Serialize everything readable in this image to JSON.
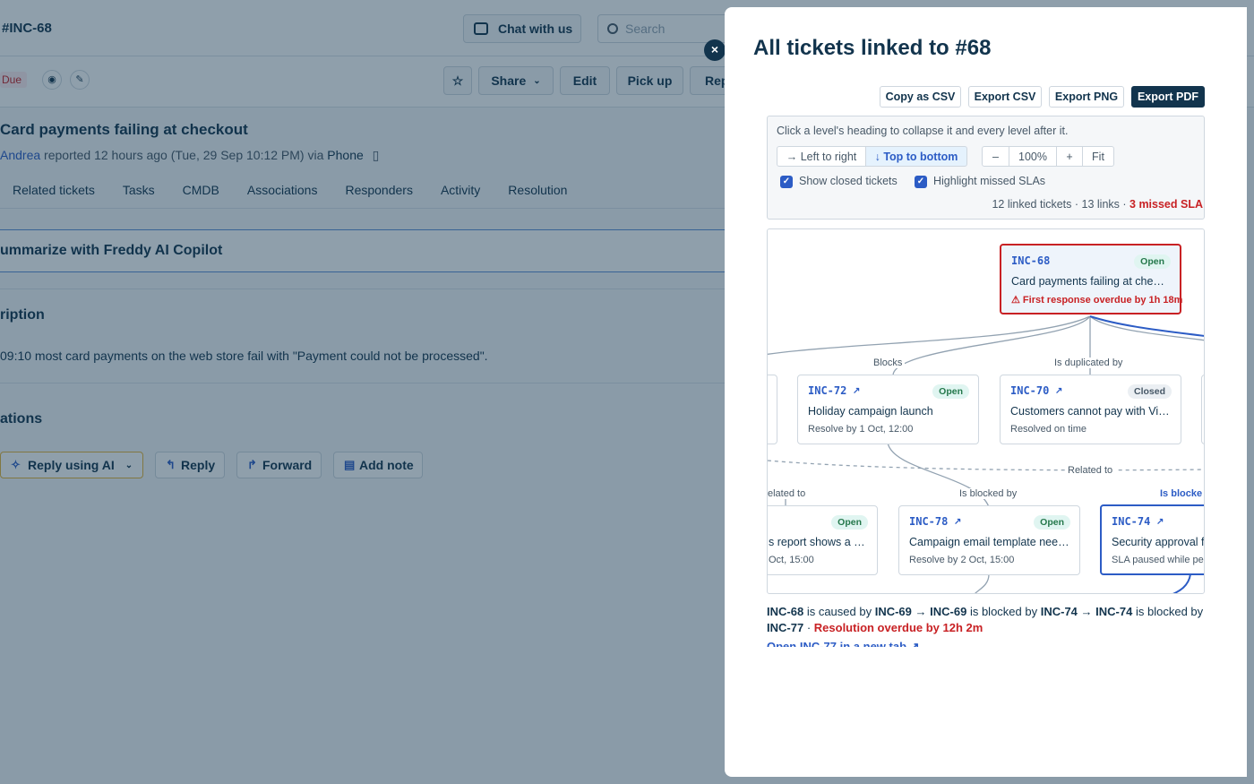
{
  "ticket": {
    "id": "#INC-68",
    "due_badge": "Due",
    "subject": "Card payments failing at checkout",
    "reporter": "Andrea",
    "reported_text": "reported 12 hours ago (Tue, 29 Sep 10:12 PM) via",
    "channel": "Phone",
    "description_title": "ription",
    "description_text": "09:10 most card payments on the web store fail with \"Payment could not be processed\".",
    "freddy_label": "ummarize with Freddy AI Copilot",
    "conversations_title": "ations"
  },
  "topbar": {
    "chat_label": "Chat with us",
    "search_placeholder": "Search"
  },
  "actions": {
    "share": "Share",
    "edit": "Edit",
    "pick_up": "Pick up",
    "reply_cut": "Rep"
  },
  "tabs": [
    "Related tickets",
    "Tasks",
    "CMDB",
    "Associations",
    "Responders",
    "Activity",
    "Resolution"
  ],
  "reply_bar": {
    "ai": "Reply using AI",
    "reply": "Reply",
    "forward": "Forward",
    "note": "Add note"
  },
  "panel": {
    "title": "All tickets linked to #68",
    "close": "×",
    "export": {
      "copy_csv": "Copy as CSV",
      "csv": "Export CSV",
      "png": "Export PNG",
      "pdf": "Export PDF"
    },
    "hint": "Click a level's heading to collapse it and every level after it.",
    "layout": {
      "ltr": "→ Left to right",
      "ttb": "↓ Top to bottom"
    },
    "zoom": {
      "minus": "–",
      "level": "100%",
      "plus": "+",
      "fit": "Fit"
    },
    "show_closed": "Show closed tickets",
    "highlight_sla": "Highlight missed SLAs",
    "summary_main": "12 linked tickets · 13 links ·",
    "summary_missed": "3 missed SLA"
  },
  "graph": {
    "nodes": {
      "root": {
        "id": "INC-68",
        "status": "Open",
        "title": "Card payments failing at che…",
        "sla": "⚠ First response overdue by 1h 18m"
      },
      "n72": {
        "id": "INC-72",
        "ext": "↗",
        "status": "Open",
        "title": "Holiday campaign launch",
        "sla": "Resolve by 1 Oct, 12:00"
      },
      "n70": {
        "id": "INC-70",
        "ext": "↗",
        "status": "Closed",
        "title": "Customers cannot pay with Vi…",
        "sla": "Resolved on time"
      },
      "nleft": {
        "status": "Open",
        "title": "s report shows a …",
        "sla": "Oct, 15:00"
      },
      "n78": {
        "id": "INC-78",
        "ext": "↗",
        "status": "Open",
        "title": "Campaign email template need…",
        "sla": "Resolve by 2 Oct, 15:00"
      },
      "n74": {
        "id": "INC-74",
        "ext": "↗",
        "title": "Security approval f",
        "sla": "SLA paused while pe"
      }
    },
    "edges": {
      "blocks": "Blocks",
      "dup": "Is duplicated by",
      "related_right": "Related to",
      "related_left": "elated to",
      "blocked_by": "Is blocked by",
      "blocked_hl": "Is blocke"
    }
  },
  "path": {
    "a": "INC-68",
    "t1": "is caused by",
    "b": "INC-69",
    "arr1": "→",
    "c": "INC-69",
    "t2": "is blocked by",
    "d": "INC-74",
    "arr2": "→",
    "e": "INC-74",
    "t3": "is blocked by",
    "f": "INC-77",
    "sep": "·",
    "overdue": "Resolution overdue by 12h 2m",
    "open_link": "Open INC-77 in a new tab ↗"
  },
  "colors": {
    "navy": "#12344d",
    "blue": "#2c5cc5",
    "red": "#c82124",
    "green": "#24784b"
  }
}
